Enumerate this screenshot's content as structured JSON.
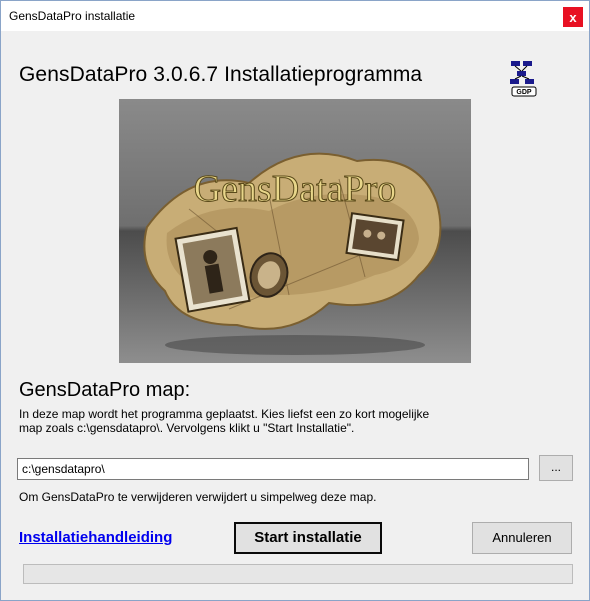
{
  "window": {
    "title": "GensDataPro installatie",
    "close_glyph": "x"
  },
  "header": {
    "heading": "GensDataPro 3.0.6.7 Installatieprogramma",
    "logo_icon": "gdp-network-logo-icon"
  },
  "hero": {
    "logo_text": "GensDataPro"
  },
  "folder": {
    "section_title": "GensDataPro map:",
    "description_line1": "In deze map wordt het programma geplaatst. Kies liefst een zo kort mogelijke",
    "description_line2": "map zoals c:\\gensdatapro\\. Vervolgens klikt u \"Start Installatie\".",
    "path_value": "c:\\gensdatapro\\",
    "browse_label": "...",
    "remove_note": "Om GensDataPro te verwijderen verwijdert u simpelweg deze map."
  },
  "actions": {
    "manual_link": "Installatiehandleiding",
    "start_label": "Start installatie",
    "cancel_label": "Annuleren"
  },
  "progress": {
    "fraction": 0
  },
  "colors": {
    "link": "#0000ee",
    "close_button": "#e81123",
    "dialog_bg": "#f0f0f0"
  }
}
